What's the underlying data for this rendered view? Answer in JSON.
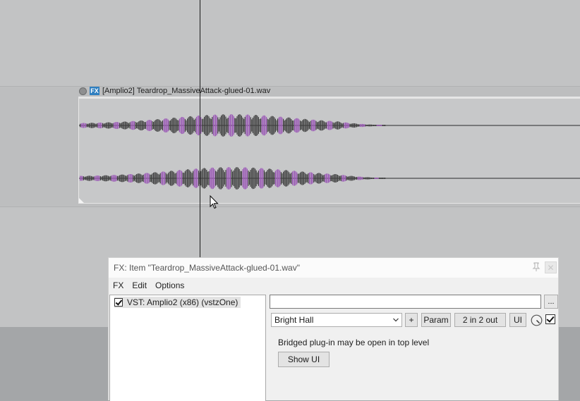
{
  "arrange": {
    "item_title": "[Amplio2] Teardrop_MassiveAttack-glued-01.wav",
    "item_fx_badge": "FX",
    "colors": {
      "background": "#c2c3c4",
      "waveform_peak": "#9b59b6",
      "waveform_body": "#3f3f3f"
    }
  },
  "fx_window": {
    "title": "FX: Item \"Teardrop_MassiveAttack-glued-01.wav\"",
    "close_symbol": "✕",
    "menu": [
      "FX",
      "Edit",
      "Options"
    ],
    "plugins": [
      {
        "label": "VST: Amplio2 (x86) (vstzOne)",
        "enabled": true
      }
    ],
    "preset_name_value": "",
    "dots_label": "...",
    "preset_selected": "Bright Hall",
    "add_label": "+",
    "param_label": "Param",
    "io_label": "2 in 2 out",
    "ui_label": "UI",
    "wet_enabled": true,
    "bridged_message": "Bridged plug-in may be open in top level",
    "show_ui_label": "Show UI"
  }
}
